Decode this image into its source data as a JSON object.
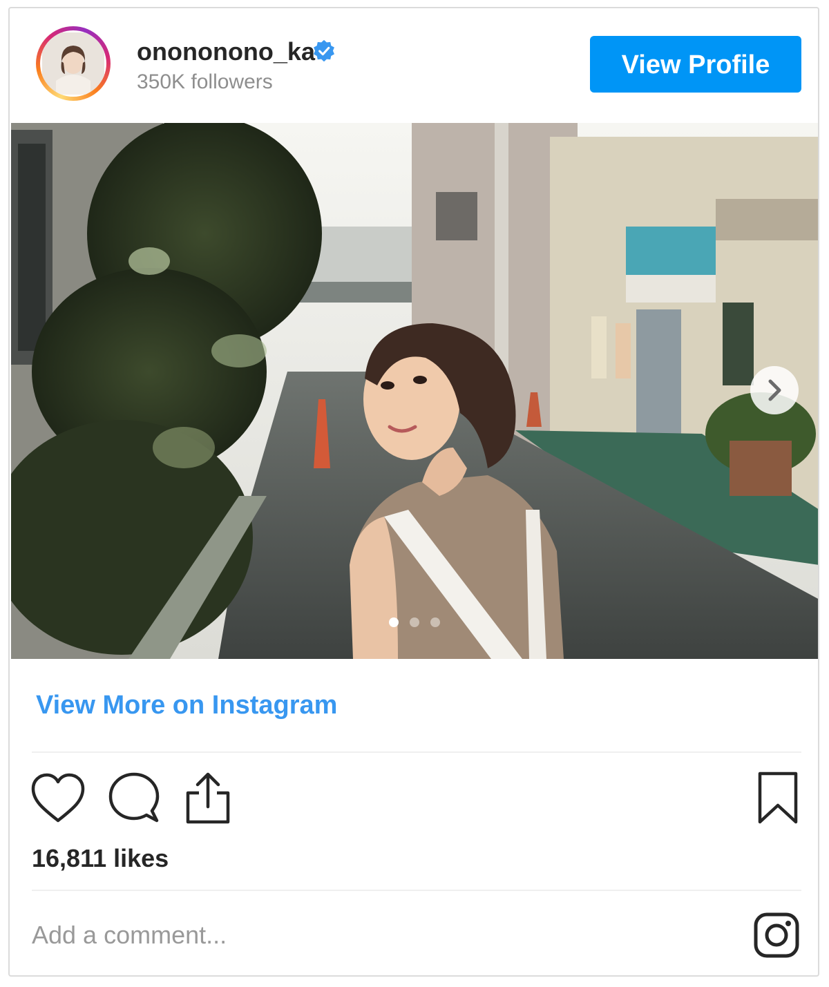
{
  "header": {
    "username": "onononono_ka",
    "followers": "350K followers",
    "view_profile_label": "View Profile",
    "verified_icon": "verified-badge-icon",
    "avatar_icon": "profile-photo"
  },
  "post": {
    "image_icon": "post-photo",
    "next_icon": "chevron-right-icon",
    "carousel": {
      "count": 3,
      "active": 1
    },
    "view_more_label": "View More on Instagram"
  },
  "actions": {
    "like_icon": "heart-icon",
    "comment_icon": "comment-bubble-icon",
    "share_icon": "share-icon",
    "save_icon": "bookmark-icon",
    "likes": "16,811 likes"
  },
  "comment": {
    "placeholder": "Add a comment...",
    "logo_icon": "instagram-logo-icon"
  },
  "colors": {
    "accent": "#0095f6",
    "link": "#3897f0",
    "verified": "#3897f0",
    "text": "#262626",
    "muted": "#8e8e8e",
    "border": "#dbdbdb"
  }
}
